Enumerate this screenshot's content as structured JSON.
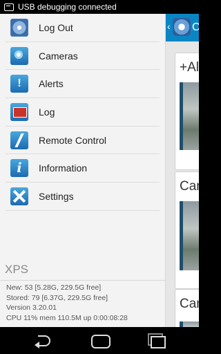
{
  "status_bar": {
    "text": "USB debugging connected"
  },
  "background_app": {
    "title": "C",
    "cards": [
      {
        "caption": "+Al"
      },
      {
        "caption": "Can"
      },
      {
        "caption": "Can"
      }
    ]
  },
  "drawer": {
    "items": [
      {
        "label": "Log Out",
        "icon": "logout-icon"
      },
      {
        "label": "Cameras",
        "icon": "camera-icon"
      },
      {
        "label": "Alerts",
        "icon": "alert-icon"
      },
      {
        "label": "Log",
        "icon": "log-icon"
      },
      {
        "label": "Remote Control",
        "icon": "lightning-icon"
      },
      {
        "label": "Information",
        "icon": "info-icon"
      },
      {
        "label": "Settings",
        "icon": "tools-icon"
      }
    ],
    "server_name": "XPS",
    "stats": {
      "new": "New: 53 [5.28G, 229.5G free]",
      "stored": "Stored: 79 [6.37G, 229.5G free]",
      "version": "Version 3.20.01",
      "cpu": "CPU 11% mem 110.5M up 0:00:08:28"
    }
  },
  "colors": {
    "accent": "#0b86c4",
    "drawer_bg": "#f3f3f3"
  }
}
